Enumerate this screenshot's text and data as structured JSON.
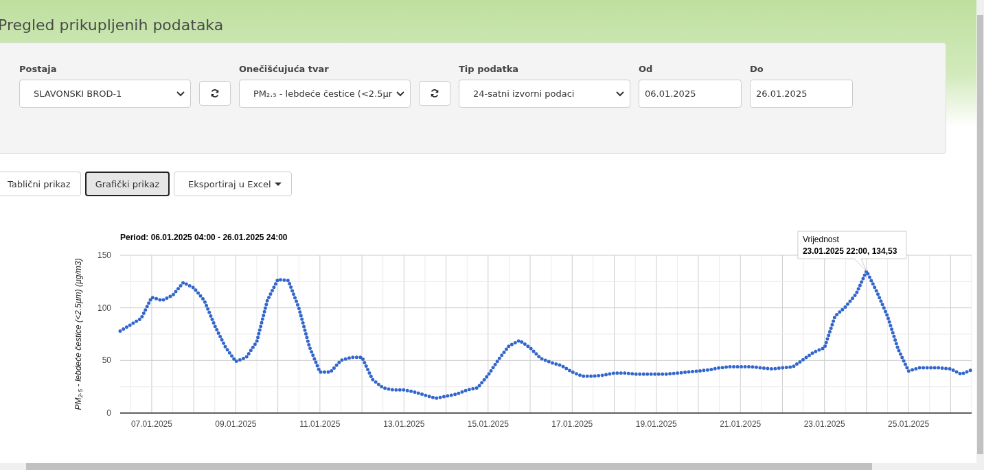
{
  "page": {
    "title": "Pregled prikupljenih podataka"
  },
  "filters": [
    {
      "kind": "select",
      "label": "Postaja",
      "value": "SLAVONSKI BROD-1",
      "refresh": true
    },
    {
      "kind": "select",
      "label": "Onečišćujuća tvar",
      "value": "PM₂.₅ - lebdeće čestice (<2.5µr",
      "refresh": true
    },
    {
      "kind": "select",
      "label": "Tip podatka",
      "value": "24-satni izvorni podaci",
      "refresh": false
    },
    {
      "kind": "date",
      "label": "Od",
      "value": "06.01.2025"
    },
    {
      "kind": "date",
      "label": "Do",
      "value": "26.01.2025"
    }
  ],
  "view_buttons": [
    {
      "kind": "tab",
      "label": "Tablični prikaz",
      "selected": false
    },
    {
      "kind": "tab",
      "label": "Grafički prikaz",
      "selected": true
    },
    {
      "kind": "menu",
      "label": "Eksportiraj u Excel",
      "selected": false
    }
  ],
  "chart": {
    "chart_data": {
      "type": "line",
      "title": "Period: 06.01.2025 04:00 - 26.01.2025 24:00",
      "ylabel": "PM₂.₅ - lebdeće čestice (<2.5µm) (µg/m3)",
      "categories": [
        null,
        null,
        null,
        "07.01.2025",
        null,
        null,
        null,
        null,
        null,
        null,
        null,
        "09.01.2025",
        null,
        null,
        null,
        null,
        null,
        null,
        null,
        "11.01.2025",
        null,
        null,
        null,
        null,
        null,
        null,
        null,
        "13.01.2025",
        null,
        null,
        null,
        null,
        null,
        null,
        null,
        "15.01.2025",
        null,
        null,
        null,
        null,
        null,
        null,
        null,
        "17.01.2025",
        null,
        null,
        null,
        null,
        null,
        null,
        null,
        "19.01.2025",
        null,
        null,
        null,
        null,
        null,
        null,
        null,
        "21.01.2025",
        null,
        null,
        null,
        null,
        null,
        null,
        null,
        "23.01.2025",
        null,
        null,
        null,
        null,
        null,
        null,
        null,
        "25.01.2025",
        null,
        null,
        null,
        null,
        null,
        null
      ],
      "series": [
        {
          "name": "Vrijednost",
          "color": "#3366cc",
          "line_style": "dotted",
          "values": [
            78,
            84,
            90,
            110,
            107,
            112,
            124,
            119,
            107,
            83,
            63,
            49,
            53,
            68,
            107,
            127,
            126,
            100,
            63,
            39,
            39,
            50,
            53,
            53,
            32,
            24,
            22,
            22,
            20,
            17,
            14,
            16,
            18,
            22,
            24,
            36,
            51,
            64,
            69,
            62,
            52,
            48,
            45,
            39,
            35,
            35,
            36,
            38,
            38,
            37,
            37,
            37,
            37,
            38,
            39,
            40,
            41,
            43,
            44,
            44,
            44,
            43,
            42,
            43,
            44,
            51,
            58,
            62,
            92,
            101,
            113,
            135,
            115,
            92,
            61,
            40,
            43,
            43,
            43,
            42,
            37,
            41
          ]
        }
      ],
      "ylim": [
        0,
        150
      ],
      "grid": true,
      "yticks": [
        0,
        50,
        100,
        150
      ],
      "annotations": [
        {
          "text": "23.01.2025 22:00, 134,53"
        }
      ]
    }
  }
}
